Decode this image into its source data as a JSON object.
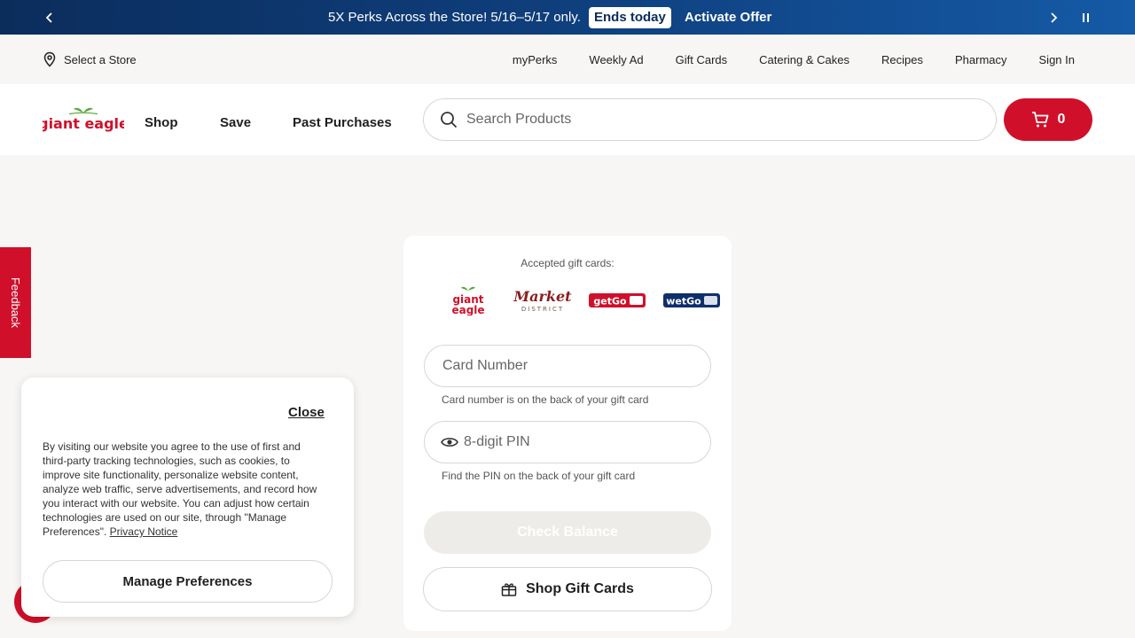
{
  "promo": {
    "message": "5X Perks Across the Store! 5/16–5/17 only.",
    "badge": "Ends today",
    "cta": "Activate Offer"
  },
  "utility": {
    "store_label": "Select a Store",
    "links": [
      "myPerks",
      "Weekly Ad",
      "Gift Cards",
      "Catering & Cakes",
      "Recipes",
      "Pharmacy",
      "Sign In"
    ]
  },
  "header": {
    "logo_text": "giant eagle",
    "nav": [
      "Shop",
      "Save",
      "Past Purchases"
    ],
    "search_placeholder": "Search Products",
    "cart_count": "0"
  },
  "feedback": {
    "label": "Feedback"
  },
  "giftcard": {
    "accepted_label": "Accepted gift cards:",
    "brands": [
      "giant eagle",
      "Market District",
      "getGo",
      "wetGo"
    ],
    "card_number_placeholder": "Card Number",
    "card_number_hint": "Card number is on the back of your gift card",
    "pin_placeholder": "8-digit PIN",
    "pin_hint": "Find the PIN on the back of your gift card",
    "check_balance": "Check Balance",
    "shop_gift_cards": "Shop Gift Cards"
  },
  "cookie": {
    "close_label": "Close",
    "body": "By visiting our website you agree to the use of first and third-party tracking technologies, such as cookies, to improve site functionality, personalize website content, analyze web traffic, serve advertisements, and record how you interact with our website. You can adjust how certain technologies are used on our site, through \"Manage Preferences\".",
    "privacy_link": "Privacy Notice",
    "manage_button": "Manage Preferences"
  },
  "colors": {
    "brand_red": "#d0102a",
    "promo_blue": "#0f3f7d",
    "background": "#f7f6f4"
  }
}
